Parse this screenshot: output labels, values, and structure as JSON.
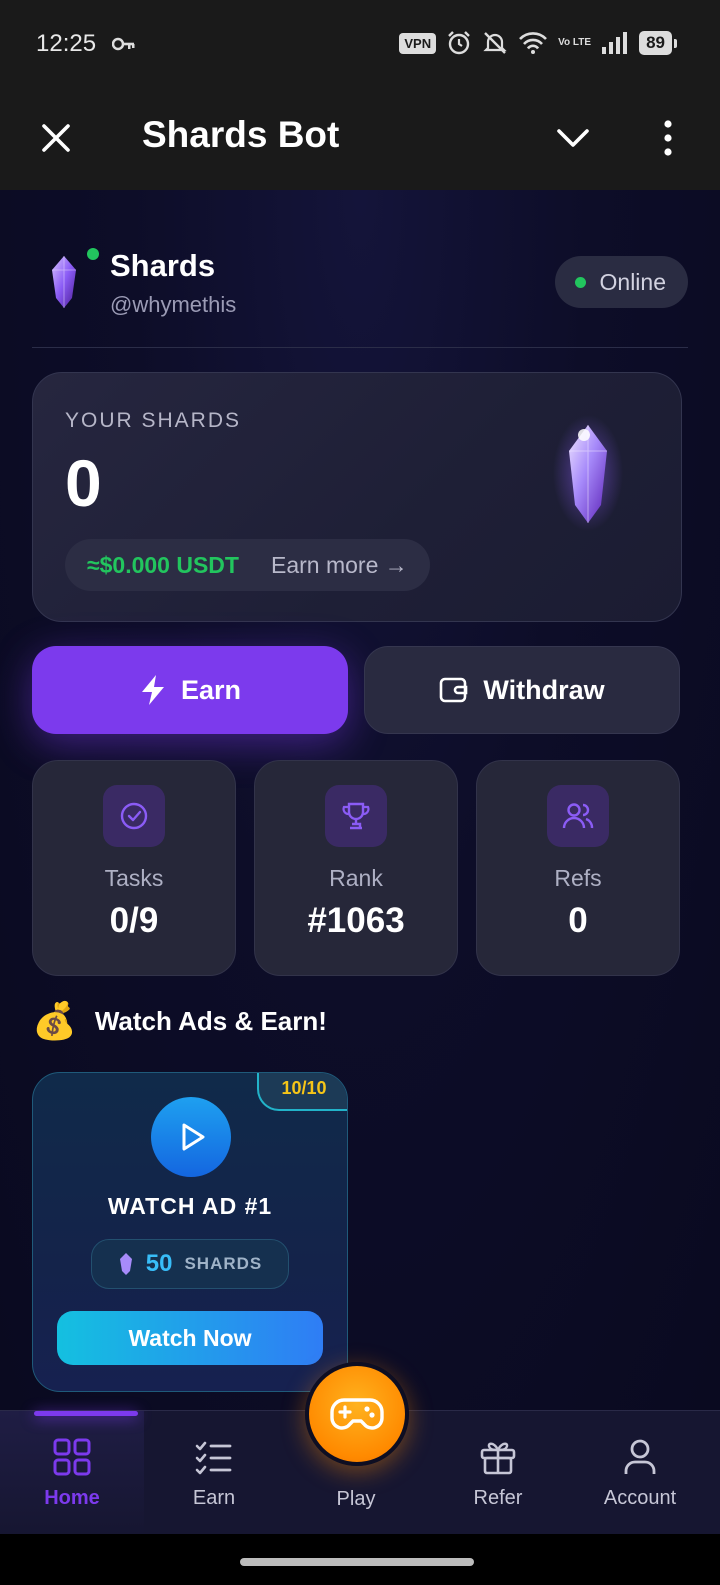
{
  "status_bar": {
    "time": "12:25",
    "vpn": "VPN",
    "volte": "Vo LTE",
    "battery": "89"
  },
  "app_bar": {
    "title": "Shards Bot"
  },
  "header": {
    "name": "Shards",
    "handle": "@whymethis",
    "status": "Online"
  },
  "balance": {
    "label": "YOUR SHARDS",
    "value": "0",
    "usdt": "≈$0.000 USDT",
    "earn_more": "Earn more →"
  },
  "actions": {
    "earn": "Earn",
    "withdraw": "Withdraw"
  },
  "stats": [
    {
      "label": "Tasks",
      "value": "0/9",
      "icon": "check-circle-icon"
    },
    {
      "label": "Rank",
      "value": "#1063",
      "icon": "trophy-icon"
    },
    {
      "label": "Refs",
      "value": "0",
      "icon": "users-icon"
    }
  ],
  "ads_section": {
    "emoji": "💰",
    "title": "Watch Ads & Earn!",
    "card": {
      "badge": "10/10",
      "title": "WATCH AD #1",
      "reward_value": "50",
      "reward_unit": "SHARDS",
      "button": "Watch Now"
    }
  },
  "nav": {
    "items": [
      {
        "label": "Home",
        "icon": "grid-icon",
        "active": true
      },
      {
        "label": "Earn",
        "icon": "checklist-icon"
      },
      {
        "label": "Play",
        "icon": "gamepad-icon"
      },
      {
        "label": "Refer",
        "icon": "gift-icon"
      },
      {
        "label": "Account",
        "icon": "user-icon"
      }
    ]
  },
  "colors": {
    "accent": "#7c3aed",
    "online": "#22c55e",
    "usdt": "#22c55e",
    "play": "#ff9500",
    "badge": "#f5c518"
  }
}
